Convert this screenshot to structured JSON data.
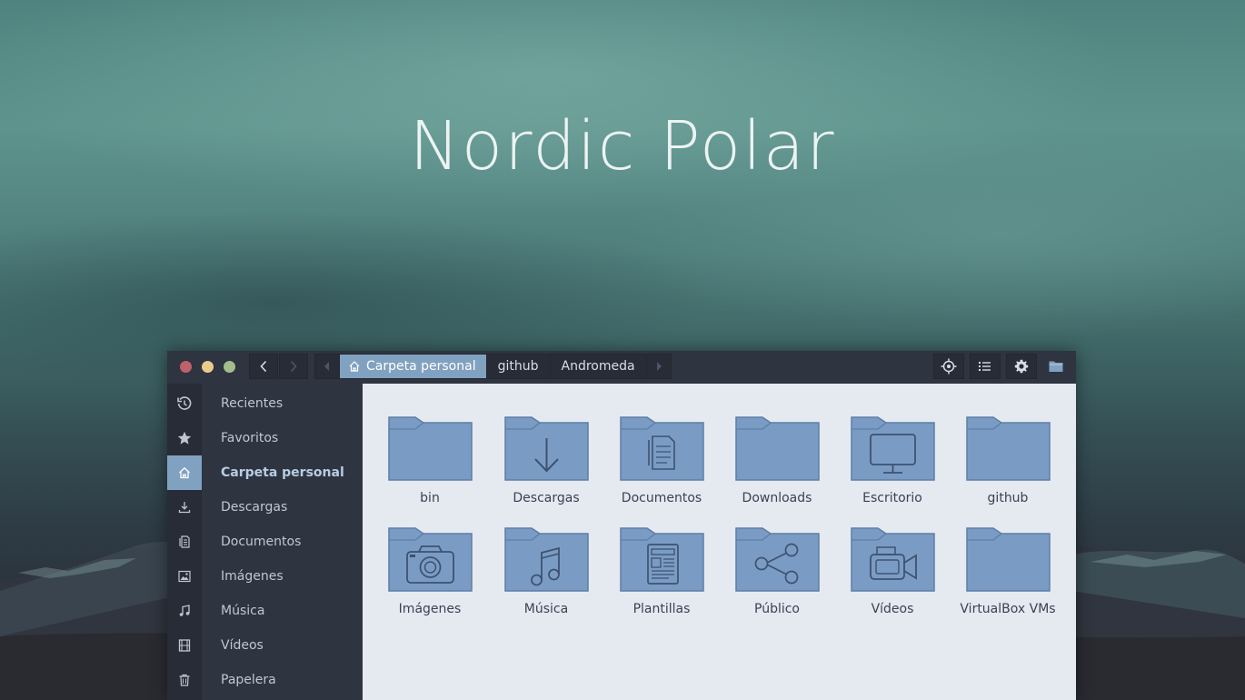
{
  "wallpaper_title": "Nordic Polar",
  "colors": {
    "accent": "#81a1c1",
    "headerbar": "#2e3440",
    "sidebar": "#2e3440",
    "content": "#e5e9f0",
    "folder": "#7a9cc4",
    "close": "#bf616a",
    "minimize": "#ebcb8b",
    "maximize": "#a3be8c"
  },
  "window": {
    "controls": [
      "close",
      "minimize",
      "maximize"
    ],
    "nav": {
      "back_icon": "chevron-left-icon",
      "forward_icon": "chevron-right-icon"
    },
    "breadcrumbs": [
      {
        "label": "Carpeta personal",
        "icon": "home-icon",
        "active": true
      },
      {
        "label": "github",
        "active": false
      },
      {
        "label": "Andromeda",
        "active": false
      }
    ],
    "toolbar_icons": [
      "locate-icon",
      "list-view-icon",
      "gear-icon",
      "folder-icon"
    ]
  },
  "sidebar": {
    "items": [
      {
        "label": "Recientes",
        "icon": "history-icon",
        "active": false
      },
      {
        "label": "Favoritos",
        "icon": "star-icon",
        "active": false
      },
      {
        "label": "Carpeta personal",
        "icon": "home-icon",
        "active": true
      },
      {
        "label": "Descargas",
        "icon": "download-icon",
        "active": false
      },
      {
        "label": "Documentos",
        "icon": "document-icon",
        "active": false
      },
      {
        "label": "Imágenes",
        "icon": "image-icon",
        "active": false
      },
      {
        "label": "Música",
        "icon": "music-icon",
        "active": false
      },
      {
        "label": "Vídeos",
        "icon": "film-icon",
        "active": false
      },
      {
        "label": "Papelera",
        "icon": "trash-icon",
        "active": false
      }
    ]
  },
  "files": [
    {
      "name": "bin",
      "emblem": "none"
    },
    {
      "name": "Descargas",
      "emblem": "download"
    },
    {
      "name": "Documentos",
      "emblem": "document"
    },
    {
      "name": "Downloads",
      "emblem": "none"
    },
    {
      "name": "Escritorio",
      "emblem": "desktop"
    },
    {
      "name": "github",
      "emblem": "none"
    },
    {
      "name": "Imágenes",
      "emblem": "camera"
    },
    {
      "name": "Música",
      "emblem": "music"
    },
    {
      "name": "Plantillas",
      "emblem": "template"
    },
    {
      "name": "Público",
      "emblem": "share"
    },
    {
      "name": "Vídeos",
      "emblem": "video"
    },
    {
      "name": "VirtualBox VMs",
      "emblem": "none"
    }
  ]
}
